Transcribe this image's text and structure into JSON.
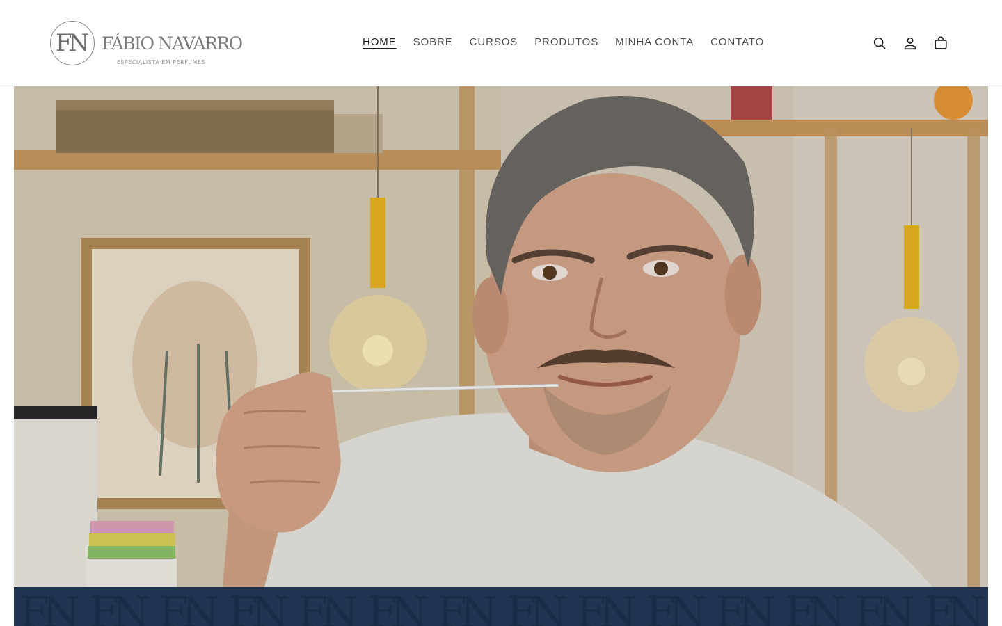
{
  "header": {
    "logo": {
      "monogram": "FN",
      "name": "FÁBIO NAVARRO",
      "tagline": "ESPECIALISTA EM PERFUMES"
    },
    "nav": [
      {
        "label": "HOME",
        "active": true
      },
      {
        "label": "SOBRE",
        "active": false
      },
      {
        "label": "CURSOS",
        "active": false
      },
      {
        "label": "PRODUTOS",
        "active": false
      },
      {
        "label": "MINHA CONTA",
        "active": false
      },
      {
        "label": "CONTATO",
        "active": false
      }
    ],
    "icons": [
      "search-icon",
      "account-icon",
      "cart-icon"
    ]
  },
  "hero": {
    "image": "man-smelling-perfume-blotter-photo"
  },
  "band": {
    "pattern_text": "FN",
    "color": "#213552"
  }
}
